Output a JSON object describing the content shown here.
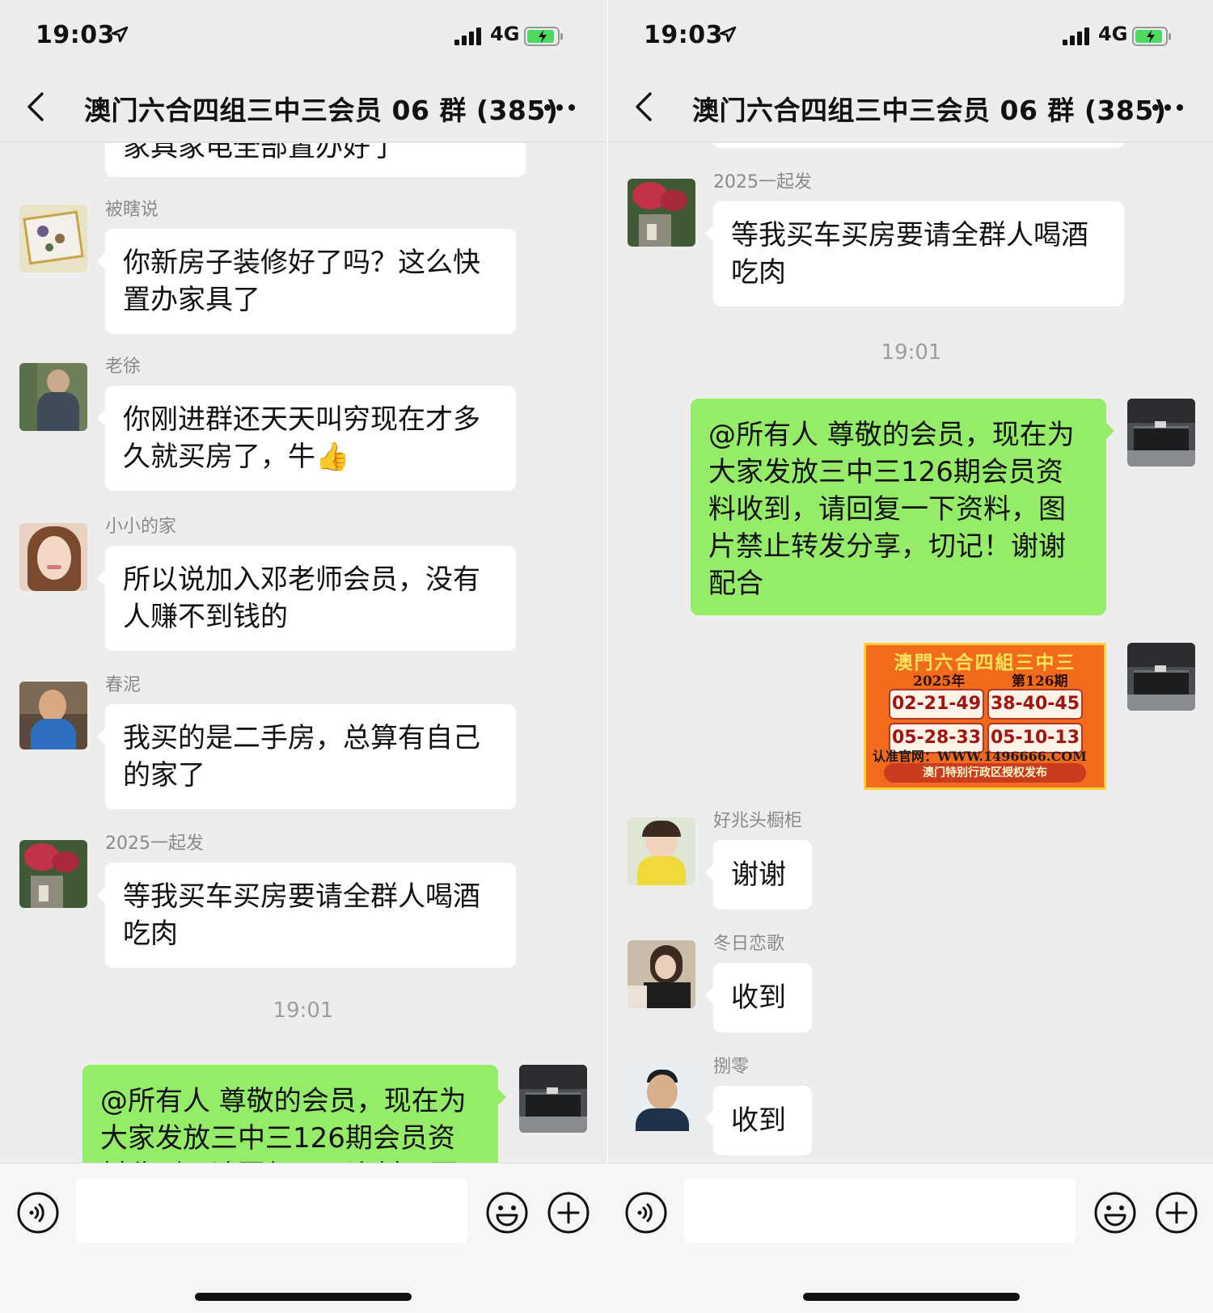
{
  "status_bar": {
    "time": "19:03",
    "network": "4G"
  },
  "header": {
    "title": "澳门六合四组三中三会员 06 群 (385)"
  },
  "left": {
    "partial_top_text": "家具家电全部置办好了",
    "messages": [
      {
        "sender": "被瞎说",
        "text": "你新房子装修好了吗？这么快置办家具了"
      },
      {
        "sender": "老徐",
        "text": "你刚进群还天天叫穷现在才多久就买房了，牛👍"
      },
      {
        "sender": "小小的家",
        "text": "所以说加入邓老师会员，没有人赚不到钱的"
      },
      {
        "sender": "春泥",
        "text": "我买的是二手房，总算有自己的家了"
      },
      {
        "sender": "2025一起发",
        "text": "等我买车买房要请全群人喝酒吃肉"
      }
    ],
    "timestamp": "19:01",
    "own_message": "@所有人 尊敬的会员，现在为大家发放三中三126期会员资料收到，请回复一下资料，图片禁止转发分享，切记！谢谢配合"
  },
  "right": {
    "messages_top": [
      {
        "sender": "2025一起发",
        "text": "等我买车买房要请全群人喝酒吃肉"
      }
    ],
    "timestamp": "19:01",
    "own_message": "@所有人 尊敬的会员，现在为大家发放三中三126期会员资料收到，请回复一下资料，图片禁止转发分享，切记！谢谢配合",
    "prize_image": {
      "heading": "澳門六合四組三中三",
      "year": "2025年",
      "issue": "第126期",
      "numbers": [
        "02-21-49",
        "38-40-45",
        "05-28-33",
        "05-10-13"
      ],
      "site": "认准官网：WWW.1496666.COM",
      "footer": "澳门特别行政区授权发布"
    },
    "messages_bottom": [
      {
        "sender": "好兆头橱柜",
        "text": "谢谢"
      },
      {
        "sender": "冬日恋歌",
        "text": "收到"
      },
      {
        "sender": "捌零",
        "text": "收到"
      }
    ]
  },
  "colors": {
    "own_bubble": "#95ec69",
    "background": "#ededed",
    "prize_bg": "#f26a1b"
  },
  "icons": [
    "location-arrow-icon",
    "signal-icon",
    "battery-icon",
    "back-icon",
    "more-icon",
    "voice-icon",
    "emoji-icon",
    "plus-icon"
  ]
}
